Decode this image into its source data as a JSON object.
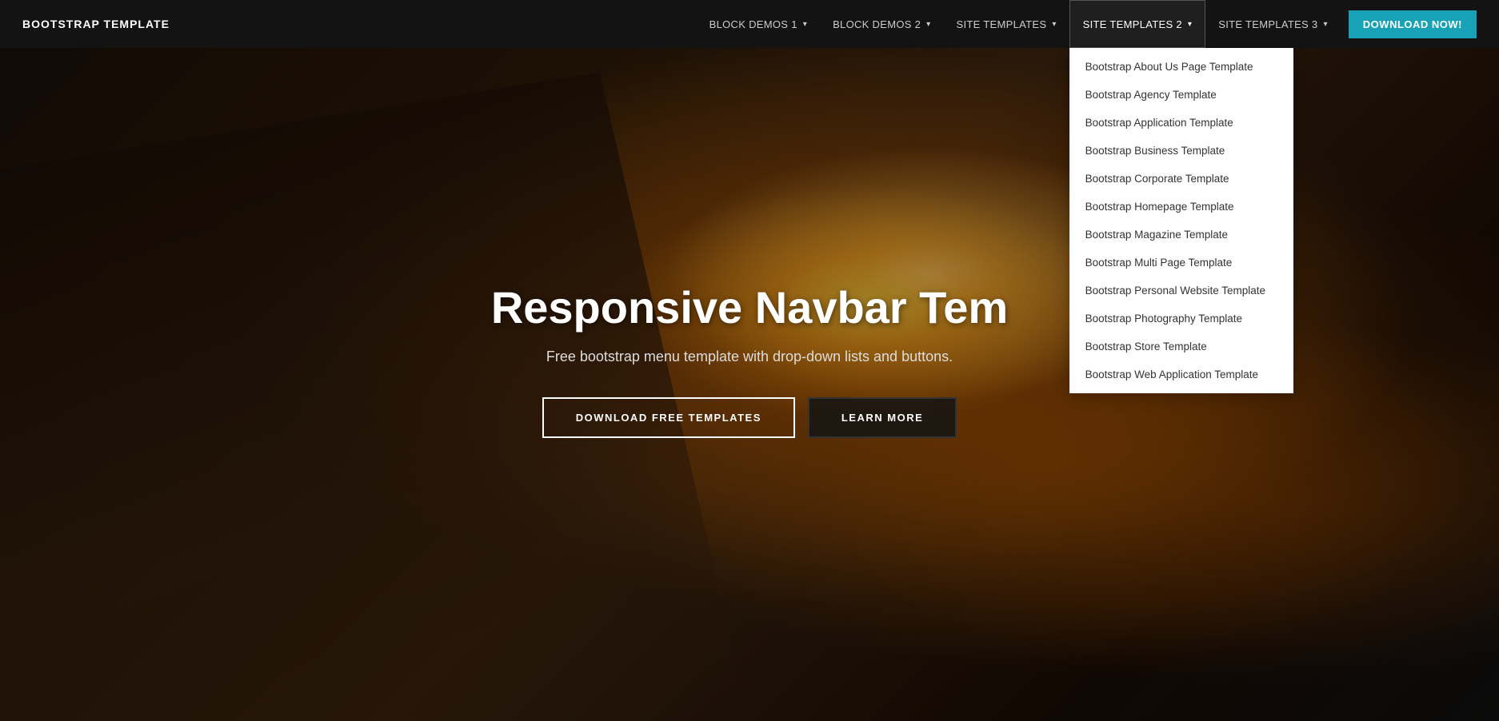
{
  "brand": {
    "name": "BOOTSTRAP TEMPLATE"
  },
  "navbar": {
    "links": [
      {
        "id": "block-demos-1",
        "label": "BLOCK DEMOS 1",
        "hasDropdown": true,
        "active": false
      },
      {
        "id": "block-demos-2",
        "label": "BLOCK DEMOS 2",
        "hasDropdown": true,
        "active": false
      },
      {
        "id": "site-templates",
        "label": "SITE TEMPLATES",
        "hasDropdown": true,
        "active": false
      },
      {
        "id": "site-templates-2",
        "label": "SITE TEMPLATES 2",
        "hasDropdown": true,
        "active": true
      },
      {
        "id": "site-templates-3",
        "label": "SITE TEMPLATES 3",
        "hasDropdown": true,
        "active": false
      }
    ],
    "downloadButton": "DOWNLOAD NOW!"
  },
  "dropdown": {
    "items": [
      "Bootstrap About Us Page Template",
      "Bootstrap Agency Template",
      "Bootstrap Application Template",
      "Bootstrap Business Template",
      "Bootstrap Corporate Template",
      "Bootstrap Homepage Template",
      "Bootstrap Magazine Template",
      "Bootstrap Multi Page Template",
      "Bootstrap Personal Website Template",
      "Bootstrap Photography Template",
      "Bootstrap Store Template",
      "Bootstrap Web Application Template"
    ]
  },
  "hero": {
    "title": "Responsive Navbar Tem...",
    "title_full": "Responsive Navbar Template",
    "subtitle": "Free bootstrap menu template with drop-down lists and buttons.",
    "btn_download": "DOWNLOAD FREE TEMPLATES",
    "btn_learn": "LEARN MORE"
  }
}
